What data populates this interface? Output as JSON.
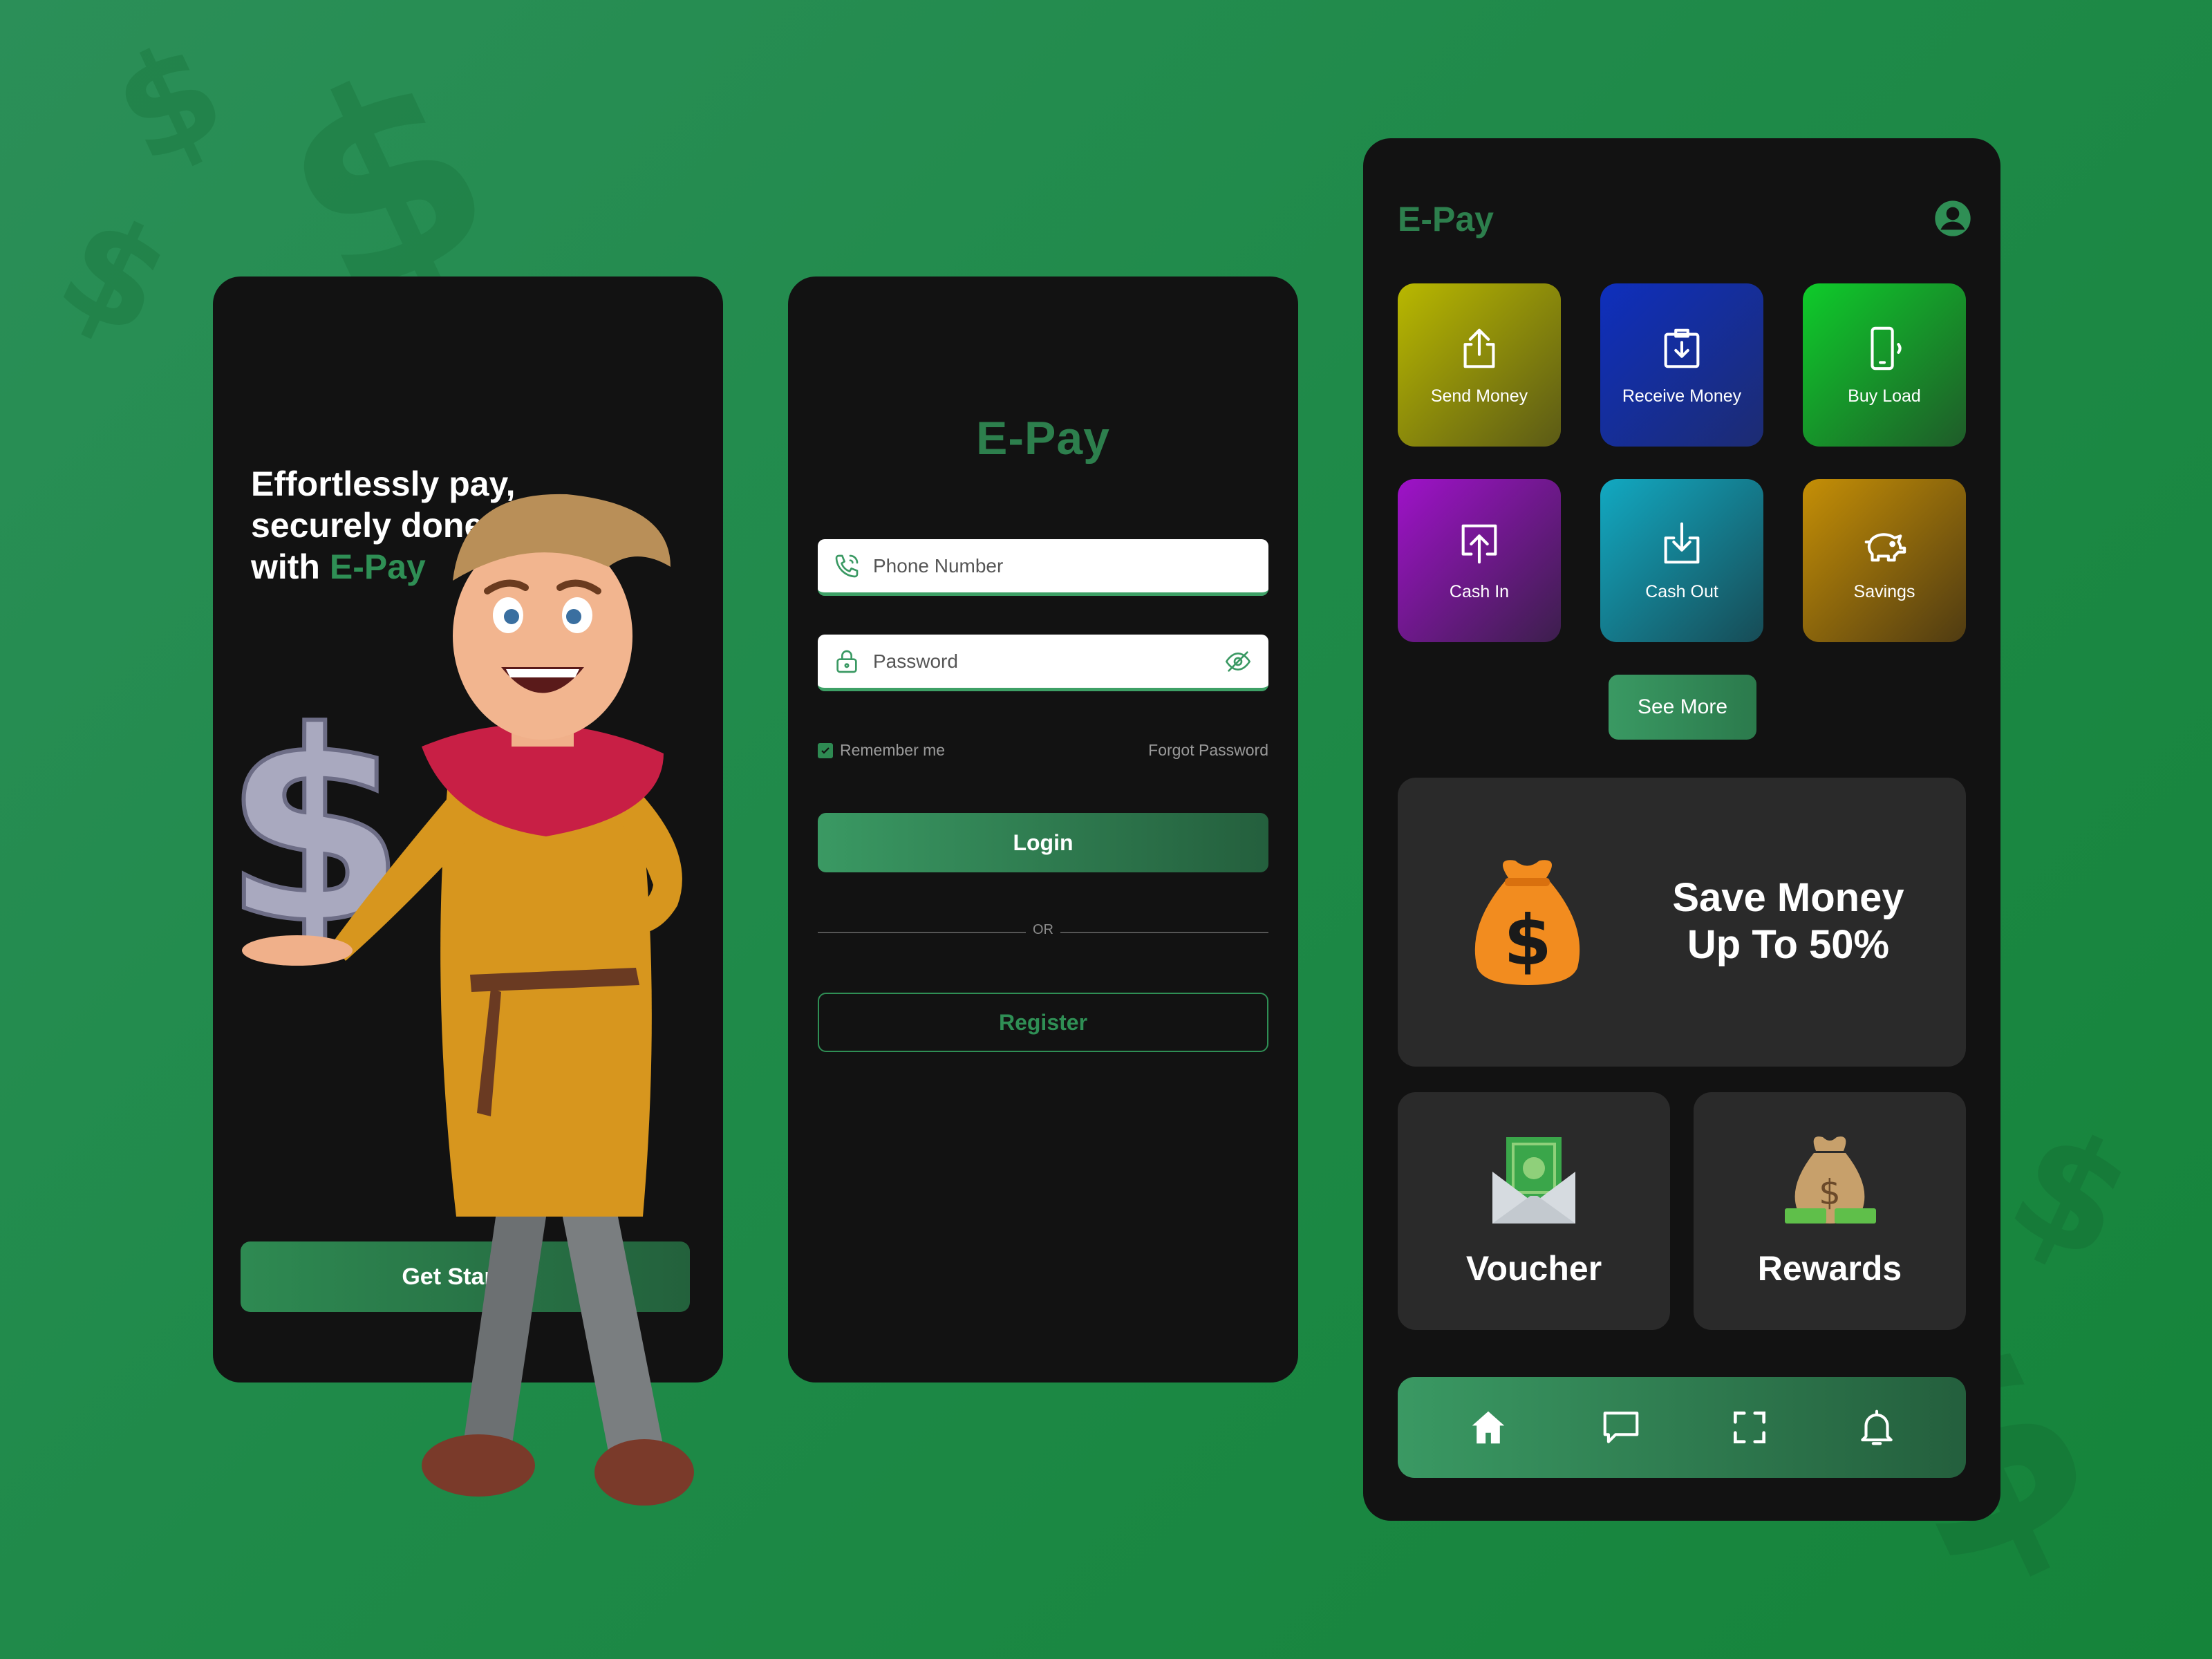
{
  "colors": {
    "background": "#1f8a49",
    "phone": "#121212",
    "accent": "#2f8f55",
    "card": "#2a2a2a"
  },
  "onboarding": {
    "headline_line1": "Effortlessly pay,",
    "headline_line2": "securely done",
    "headline_with": "with",
    "headline_brand": "E-Pay",
    "get_started_label": "Get Started"
  },
  "login": {
    "brand": "E-Pay",
    "phone_placeholder": "Phone Number",
    "password_placeholder": "Password",
    "remember_label": "Remember me",
    "forgot_label": "Forgot Password",
    "login_label": "Login",
    "or_label": "OR",
    "register_label": "Register"
  },
  "dashboard": {
    "brand": "E-Pay",
    "tiles": [
      {
        "label": "Send Money",
        "icon": "upload-icon"
      },
      {
        "label": "Receive Money",
        "icon": "download-box-icon"
      },
      {
        "label": "Buy Load",
        "icon": "phone-icon"
      },
      {
        "label": "Cash In",
        "icon": "arrow-up-box-icon"
      },
      {
        "label": "Cash Out",
        "icon": "arrow-down-box-icon"
      },
      {
        "label": "Savings",
        "icon": "piggy-bank-icon"
      }
    ],
    "see_more_label": "See More",
    "promo_line1": "Save Money",
    "promo_line2": "Up To 50%",
    "voucher_label": "Voucher",
    "rewards_label": "Rewards",
    "nav": [
      "home-icon",
      "chat-icon",
      "scan-icon",
      "bell-icon"
    ]
  }
}
